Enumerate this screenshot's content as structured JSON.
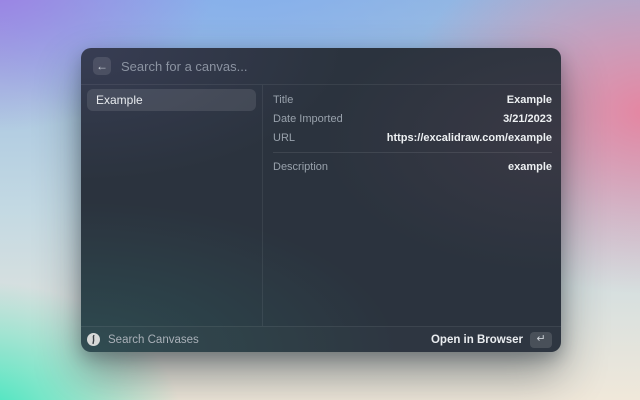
{
  "window": {
    "search": {
      "placeholder": "Search for a canvas...",
      "back_icon": "←"
    },
    "sidebar": {
      "items": [
        {
          "label": "Example",
          "selected": true
        }
      ]
    },
    "details": {
      "rows": [
        {
          "label": "Title",
          "value": "Example"
        },
        {
          "label": "Date Imported",
          "value": "3/21/2023"
        },
        {
          "label": "URL",
          "value": "https://excalidraw.com/example"
        },
        {
          "label": "Description",
          "value": "example"
        }
      ]
    },
    "footer": {
      "command_label": "Search Canvases",
      "command_icon": "excalidraw-logo",
      "primary_action": {
        "label": "Open in Browser",
        "key_hint": "↵"
      }
    }
  },
  "colors": {
    "window_bg": "#2b333e",
    "selected_item_bg": "rgba(255,255,255,0.10)",
    "detail_label": "#99a2ac",
    "detail_value": "#edf0f2",
    "placeholder_text": "#8b93a1",
    "backdrop_purple": "#9c7ce4",
    "backdrop_blue": "#83aeee",
    "backdrop_pink": "#e8829e",
    "backdrop_teal": "#2fe5bd",
    "backdrop_cream": "#f0e8da"
  }
}
